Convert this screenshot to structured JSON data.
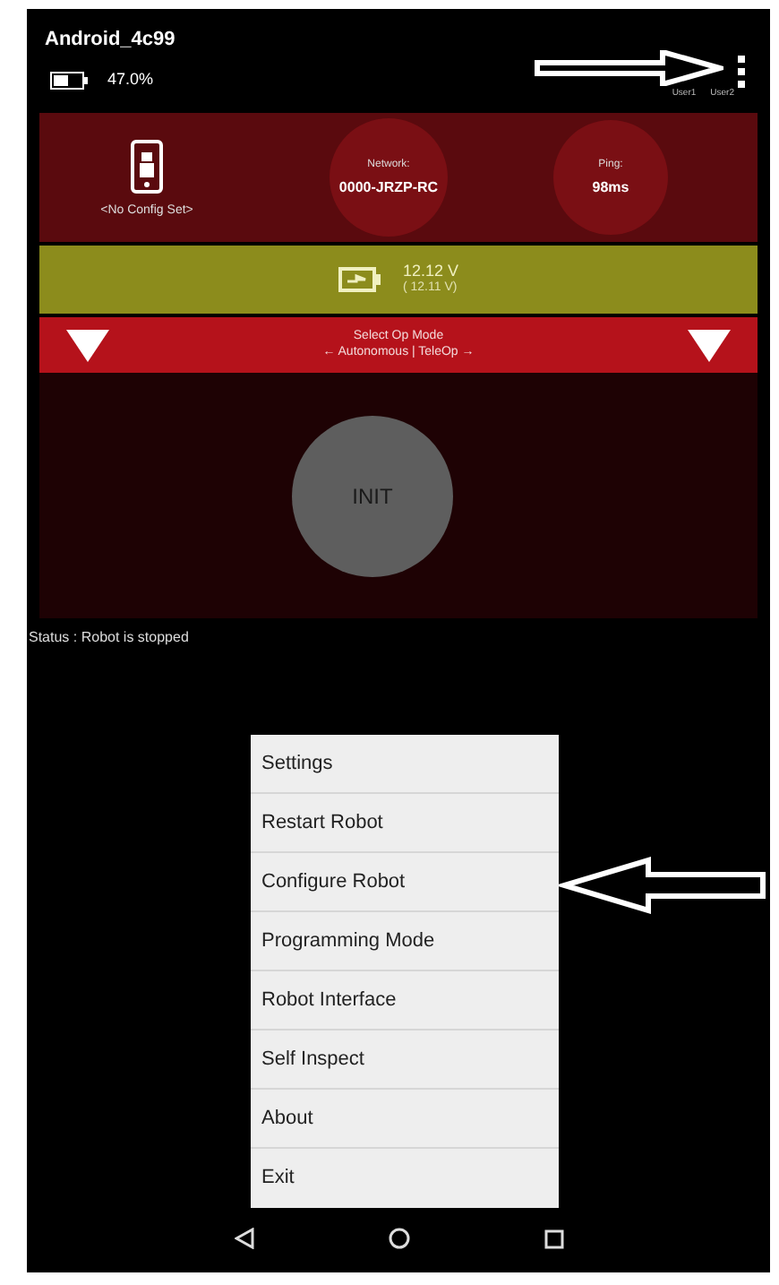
{
  "header": {
    "device_name": "Android_4c99",
    "battery": "47.0%",
    "users": [
      "User1",
      "User2"
    ]
  },
  "robot_panel": {
    "config": "<No Config Set>",
    "network_label": "Network:",
    "network": "0000-JRZP-RC",
    "ping_label": "Ping:",
    "ping": "98ms"
  },
  "voltage": {
    "value": "12.12 V",
    "min": "( 12.11 V)"
  },
  "op_mode": {
    "title": "Select Op Mode",
    "subtitle": "← Autonomous | TeleOp →"
  },
  "init_button": "INIT",
  "status": "Status : Robot is stopped",
  "menu": [
    {
      "label": "Settings"
    },
    {
      "label": "Restart Robot"
    },
    {
      "label": "Configure Robot"
    },
    {
      "label": "Programming Mode"
    },
    {
      "label": "Robot Interface"
    },
    {
      "label": "Self Inspect"
    },
    {
      "label": "About"
    },
    {
      "label": "Exit"
    }
  ]
}
